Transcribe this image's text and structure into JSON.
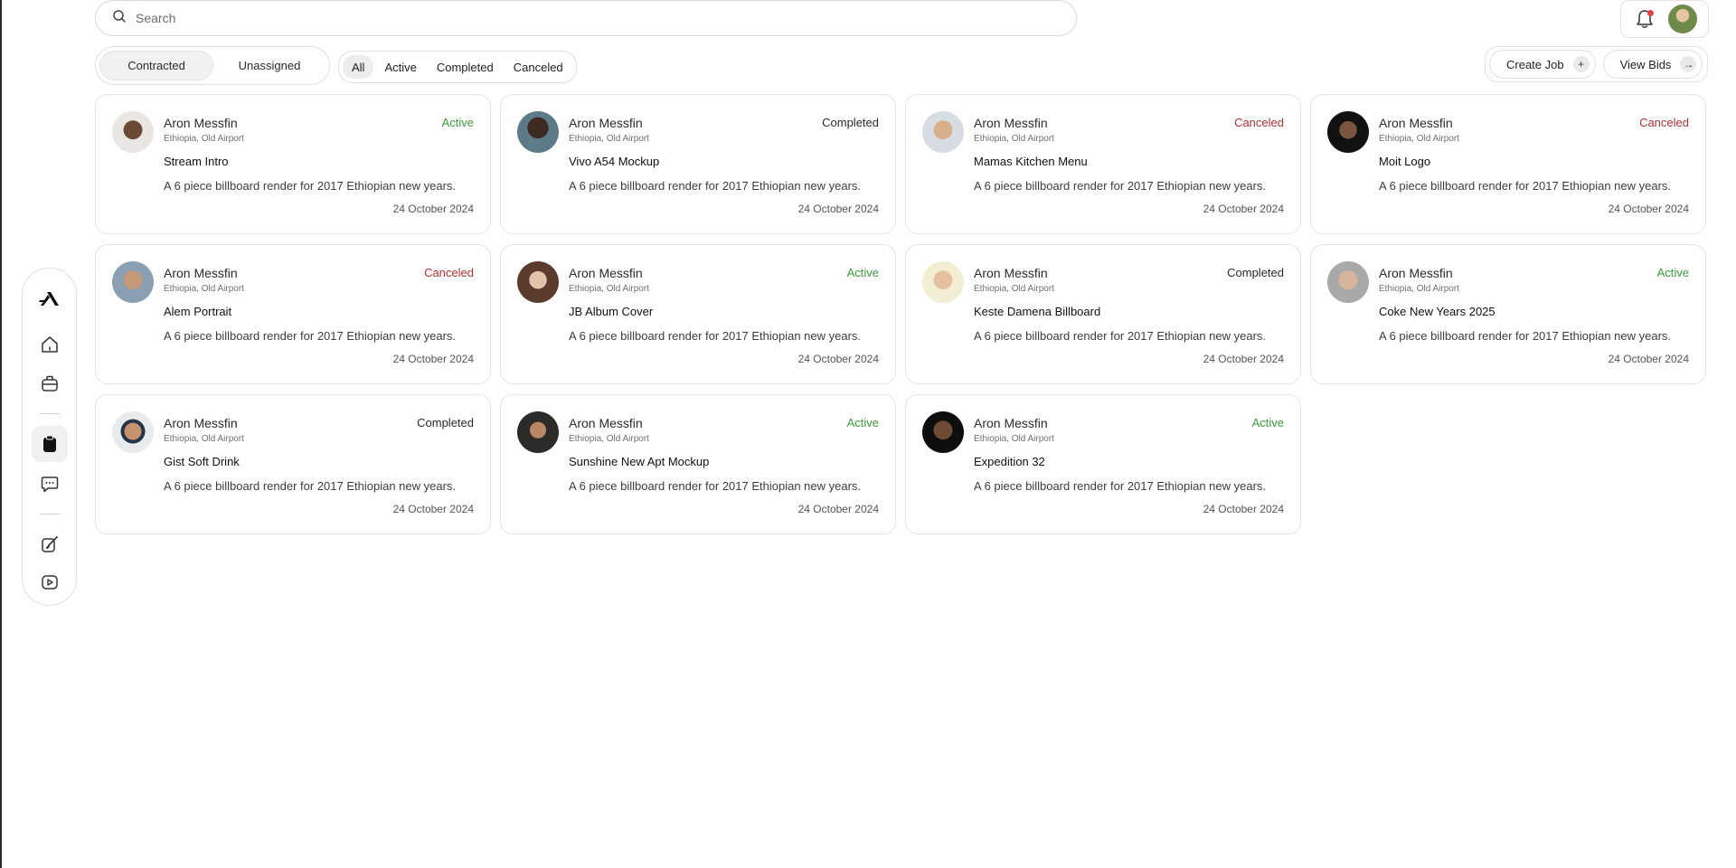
{
  "search": {
    "placeholder": "Search"
  },
  "tabs": {
    "contracted": "Contracted",
    "unassigned": "Unassigned"
  },
  "filters": {
    "all": "All",
    "active": "Active",
    "completed": "Completed",
    "canceled": "Canceled"
  },
  "actions": {
    "create_job": "Create Job",
    "view_bids": "View Bids"
  },
  "colors": {
    "active": "#3c9a3a",
    "canceled": "#b03131",
    "completed": "#2a2a2a"
  },
  "jobs": [
    {
      "name": "Aron Messfin",
      "location": "Ethiopia, Old Airport",
      "title": "Stream Intro",
      "description": "A 6 piece billboard render for 2017 Ethiopian new years.",
      "date": "24 October 2024",
      "status": "Active"
    },
    {
      "name": "Aron Messfin",
      "location": "Ethiopia, Old Airport",
      "title": "Vivo A54 Mockup",
      "description": "A 6 piece billboard render for 2017 Ethiopian new years.",
      "date": "24 October 2024",
      "status": "Completed"
    },
    {
      "name": "Aron Messfin",
      "location": "Ethiopia, Old Airport",
      "title": "Mamas Kitchen Menu",
      "description": "A 6 piece billboard render for 2017 Ethiopian new years.",
      "date": "24 October 2024",
      "status": "Canceled"
    },
    {
      "name": "Aron Messfin",
      "location": "Ethiopia, Old Airport",
      "title": "Moit Logo",
      "description": "A 6 piece billboard render for 2017 Ethiopian new years.",
      "date": "24 October 2024",
      "status": "Canceled"
    },
    {
      "name": "Aron Messfin",
      "location": "Ethiopia, Old Airport",
      "title": "Alem Portrait",
      "description": "A 6 piece billboard render for 2017 Ethiopian new years.",
      "date": "24 October 2024",
      "status": "Canceled"
    },
    {
      "name": "Aron Messfin",
      "location": "Ethiopia, Old Airport",
      "title": "JB Album Cover",
      "description": "A 6 piece billboard render for 2017 Ethiopian new years.",
      "date": "24 October 2024",
      "status": "Active"
    },
    {
      "name": "Aron Messfin",
      "location": "Ethiopia, Old Airport",
      "title": "Keste Damena Billboard",
      "description": "A 6 piece billboard render for 2017 Ethiopian new years.",
      "date": "24 October 2024",
      "status": "Completed"
    },
    {
      "name": "Aron Messfin",
      "location": "Ethiopia, Old Airport",
      "title": "Coke New Years 2025",
      "description": "A 6 piece billboard render for 2017 Ethiopian new years.",
      "date": "24 October 2024",
      "status": "Active"
    },
    {
      "name": "Aron Messfin",
      "location": "Ethiopia, Old Airport",
      "title": "Gist Soft Drink",
      "description": "A 6 piece billboard render for 2017 Ethiopian new years.",
      "date": "24 October 2024",
      "status": "Completed"
    },
    {
      "name": "Aron Messfin",
      "location": "Ethiopia, Old Airport",
      "title": "Sunshine New Apt Mockup",
      "description": "A 6 piece billboard render for 2017 Ethiopian new years.",
      "date": "24 October 2024",
      "status": "Active"
    },
    {
      "name": "Aron Messfin",
      "location": "Ethiopia, Old Airport",
      "title": "Expedition 32",
      "description": "A 6 piece billboard render for 2017 Ethiopian new years.",
      "date": "24 October 2024",
      "status": "Active"
    }
  ]
}
